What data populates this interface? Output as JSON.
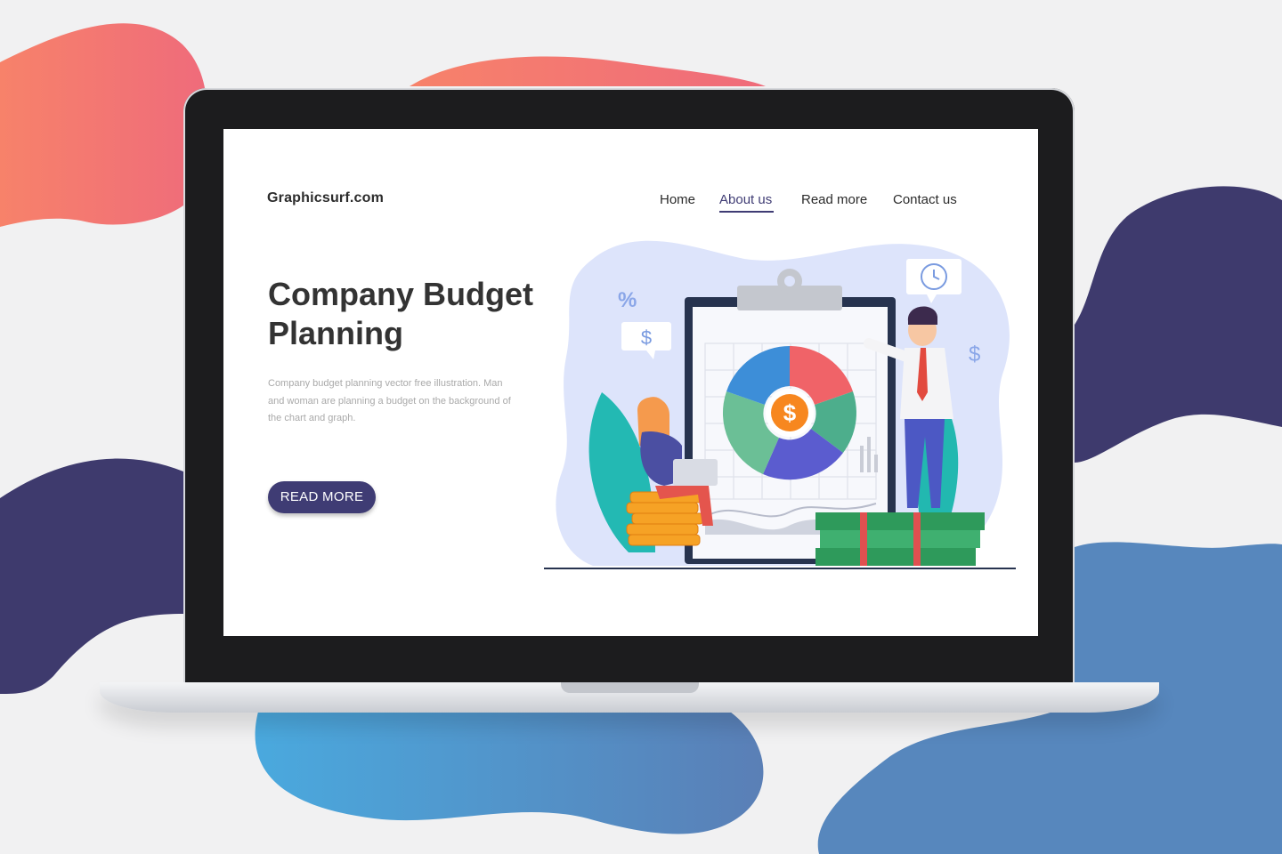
{
  "header": {
    "brand": "Graphicsurf.com",
    "nav": [
      {
        "label": "Home",
        "active": false
      },
      {
        "label": "About us",
        "active": true
      },
      {
        "label": "Read more",
        "active": false
      },
      {
        "label": "Contact us",
        "active": false
      }
    ]
  },
  "hero": {
    "title_line1": "Company Budget",
    "title_line2": "Planning",
    "description": "Company budget planning vector free illustration. Man and woman are planning a budget on the background of the chart and graph.",
    "cta_label": "READ MORE"
  },
  "illustration": {
    "percent_symbol": "%",
    "dollar_symbol": "$"
  },
  "colors": {
    "accent": "#3f3c74",
    "coral": "#f47a6d",
    "navy": "#3e3a6d",
    "blue": "#5b94cc"
  }
}
